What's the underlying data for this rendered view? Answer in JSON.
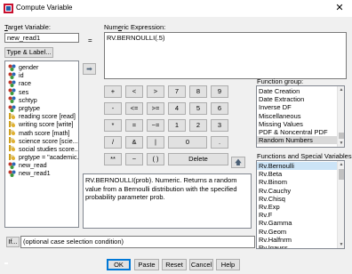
{
  "window": {
    "title": "Compute Variable",
    "close": "✕"
  },
  "target": {
    "label_u": "T",
    "label_rest": "arget Variable:",
    "value": "new_read1",
    "type_label_button": "Type & Label..."
  },
  "equals": "=",
  "expression": {
    "label_pre": "Num",
    "label_u": "e",
    "label_rest": "ric Expression:",
    "value": "RV.BERNOULLI(.5)"
  },
  "variables": [
    {
      "label": "gender",
      "kind": "nominal"
    },
    {
      "label": "id",
      "kind": "nominal"
    },
    {
      "label": "race",
      "kind": "nominal"
    },
    {
      "label": "ses",
      "kind": "nominal"
    },
    {
      "label": "schtyp",
      "kind": "nominal"
    },
    {
      "label": "prgtype",
      "kind": "nominal"
    },
    {
      "label": "reading score [read]",
      "kind": "scale"
    },
    {
      "label": "writing score [write]",
      "kind": "scale"
    },
    {
      "label": "math score [math]",
      "kind": "scale"
    },
    {
      "label": "science score [scie...",
      "kind": "scale"
    },
    {
      "label": "social studies score...",
      "kind": "scale"
    },
    {
      "label": "prgtype = \"academic...",
      "kind": "scale"
    },
    {
      "label": "new_read",
      "kind": "nominal"
    },
    {
      "label": "new_read1",
      "kind": "nominal"
    }
  ],
  "keypad": {
    "row1": [
      "+",
      "<",
      ">",
      "7",
      "8",
      "9"
    ],
    "row2": [
      "-",
      "<=",
      ">=",
      "4",
      "5",
      "6"
    ],
    "row3": [
      "*",
      "=",
      "~=",
      "1",
      "2",
      "3"
    ],
    "row4": [
      "/",
      "&",
      "|",
      "0",
      "."
    ],
    "row5": [
      "**",
      "~",
      "( )",
      "Delete"
    ]
  },
  "arrow_glyph": "➡",
  "up_arrow_glyph": "🡅",
  "function_group": {
    "label": "Function group:",
    "items": [
      "Date Creation",
      "Date Extraction",
      "Inverse DF",
      "Miscellaneous",
      "Missing Values",
      "PDF & Noncentral PDF",
      "Random Numbers"
    ],
    "selected": "Random Numbers"
  },
  "functions": {
    "label": "Functions and Special Variables:",
    "items": [
      "Rv.Bernoulli",
      "Rv.Beta",
      "Rv.Binom",
      "Rv.Cauchy",
      "Rv.Chisq",
      "Rv.Exp",
      "Rv.F",
      "Rv.Gamma",
      "Rv.Geom",
      "Rv.Halfnrm",
      "Rv.Igauss"
    ],
    "selected": "Rv.Bernoulli"
  },
  "description": "RV.BERNOULLI(prob). Numeric. Returns a random value from a Bernoulli distribution with the specified probability parameter prob.",
  "if_button": "If...",
  "if_text": "(optional case selection condition)",
  "buttons": {
    "ok": "OK",
    "paste": "Paste",
    "reset": "Reset",
    "cancel": "Cancel",
    "help": "Help"
  },
  "colors": {
    "selection": "#cce4f7",
    "primary_border": "#0078d7"
  }
}
